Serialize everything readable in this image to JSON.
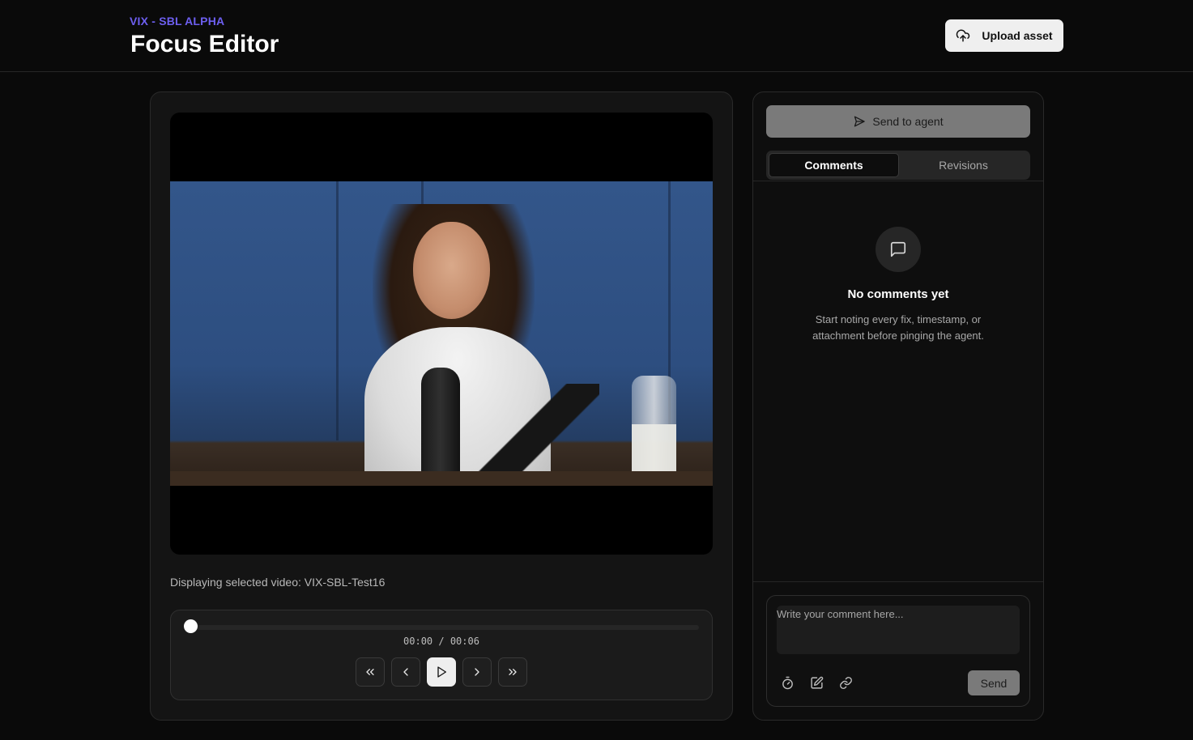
{
  "header": {
    "eyebrow": "VIX - SBL ALPHA",
    "title": "Focus Editor",
    "upload_label": "Upload asset",
    "upload_icon": "cloud-upload-icon"
  },
  "player": {
    "caption": "Displaying selected video: VIX-SBL-Test16",
    "progress": 0,
    "time": "00:00 / 00:06",
    "controls": [
      {
        "name": "skip-back-button",
        "icon": "chevrons-left-icon"
      },
      {
        "name": "step-back-button",
        "icon": "chevron-left-icon"
      },
      {
        "name": "play-button",
        "icon": "play-icon"
      },
      {
        "name": "step-forward-button",
        "icon": "chevron-right-icon"
      },
      {
        "name": "skip-forward-button",
        "icon": "chevrons-right-icon"
      }
    ]
  },
  "sidebar": {
    "send_agent_label": "Send to agent",
    "tabs": [
      {
        "label": "Comments",
        "active": true
      },
      {
        "label": "Revisions",
        "active": false
      }
    ],
    "empty_title": "No comments yet",
    "empty_desc": "Start noting every fix, timestamp, or attachment before pinging the agent.",
    "composer": {
      "placeholder": "Write your comment here...",
      "send_label": "Send",
      "tools": [
        "timer-icon",
        "edit-icon",
        "link-icon"
      ]
    }
  },
  "colors": {
    "accent": "#6d5ff0",
    "background": "#0a0a0a"
  }
}
